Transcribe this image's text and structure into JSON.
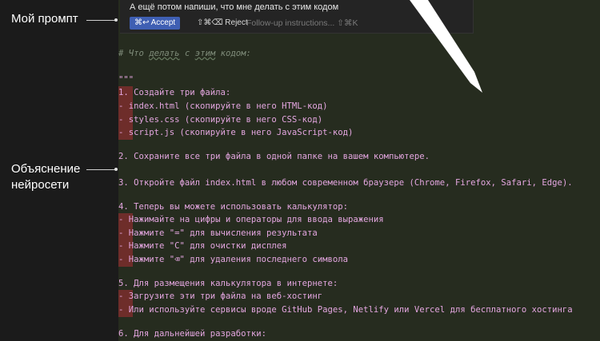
{
  "annotations": {
    "prompt_label": "Мой промпт",
    "explain_label_line1": "Объяснение",
    "explain_label_line2": "нейросети"
  },
  "prompt": {
    "text": "А ещё потом напиши, что мне делать с этим кодом",
    "accept_label": "⌘↩ Accept",
    "reject_label": "⇧⌘⌫ Reject",
    "followup_placeholder": "Follow-up instructions... ⇧⌘K"
  },
  "code": {
    "comment_prefix": "# Что ",
    "comment_word1": "делать",
    "comment_mid": " с ",
    "comment_word2": "этим",
    "comment_suffix": " кодом:",
    "docstring": "\"\"\"",
    "lines": [
      "1. Создайте три файла:",
      "   - index.html (скопируйте в него HTML-код)",
      "   - styles.css (скопируйте в него CSS-код)",
      "   - script.js (скопируйте в него JavaScript-код)",
      "2. Сохраните все три файла в одной папке на вашем компьютере.",
      "3. Откройте файл index.html в любом современном браузере (Chrome, Firefox, Safari, Edge).",
      "4. Теперь вы можете использовать калькулятор:",
      "   - Нажимайте на цифры и операторы для ввода выражения",
      "   - Нажмите \"=\" для вычисления результата",
      "   - Нажмите \"C\" для очистки дисплея",
      "   - Нажмите \"⌫\" для удаления последнего символа",
      "5. Для размещения калькулятора в интернете:",
      "   - Загрузите эти три файла на веб-хостинг",
      "   - Или используйте сервисы вроде GitHub Pages, Netlify или Vercel для бесплатного хостинга",
      "6. Для дальнейшей разработки:"
    ]
  },
  "colors": {
    "editor_bg": "#262c1f",
    "code_text": "#e4a6e0",
    "comment": "#7f8c7a",
    "gutter_mark": "#6e2d2a",
    "accept_bg": "#3f5fb3"
  }
}
